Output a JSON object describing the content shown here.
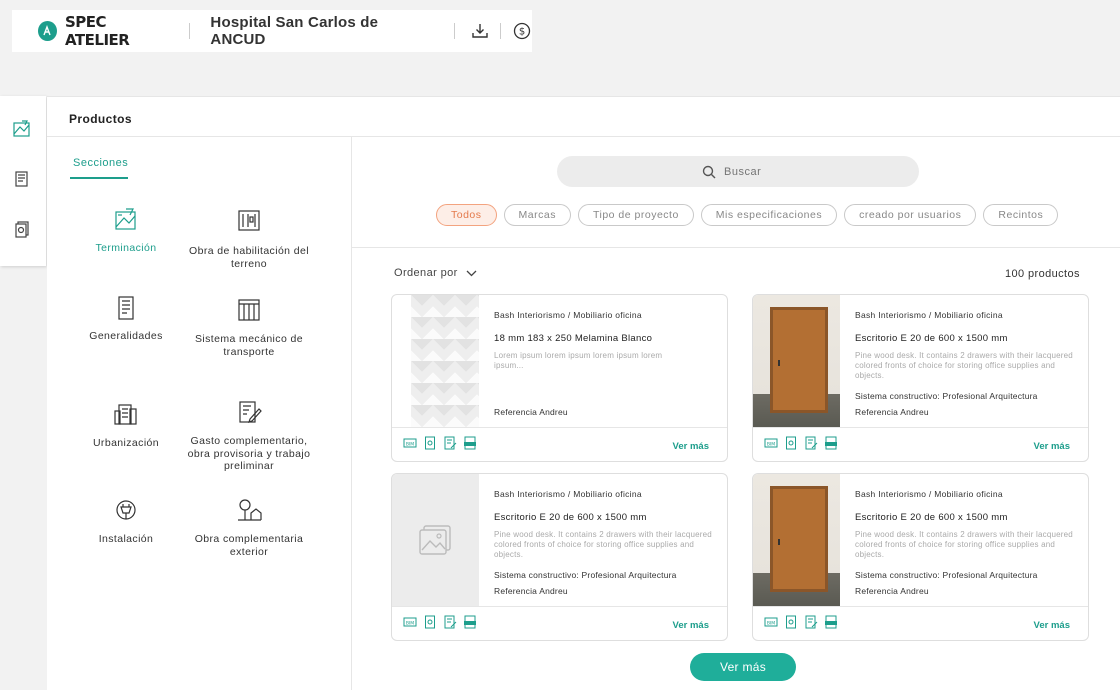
{
  "app": {
    "name": "SPEC ATELIER",
    "project": "Hospital San Carlos de ANCUD"
  },
  "colors": {
    "accent": "#1d9e8c",
    "chip_active": "#e47a4c"
  },
  "panel": {
    "title": "Productos"
  },
  "sections": {
    "label": "Secciones",
    "items": [
      {
        "label": "Terminación",
        "icon": "finishes-icon",
        "active": true
      },
      {
        "label": "Obra de habilitación del terreno",
        "icon": "site-prep-icon"
      },
      {
        "label": "Generalidades",
        "icon": "document-icon"
      },
      {
        "label": "Sistema mecánico de transporte",
        "icon": "elevator-icon"
      },
      {
        "label": "Urbanización",
        "icon": "buildings-icon"
      },
      {
        "label": "Gasto complementario, obra provisoria y trabajo preliminar",
        "icon": "edit-document-icon"
      },
      {
        "label": "Instalación",
        "icon": "plug-icon"
      },
      {
        "label": "Obra complementaria exterior",
        "icon": "landscape-icon"
      }
    ]
  },
  "search": {
    "placeholder": "Buscar"
  },
  "filters": [
    "Todos",
    "Marcas",
    "Tipo de proyecto",
    "Mis especificaciones",
    "creado por usuarios",
    "Recintos"
  ],
  "sort": {
    "label": "Ordenar por"
  },
  "count": "100 productos",
  "products": [
    {
      "brand": "Bash Interiorismo / Mobiliario oficina",
      "name": "18 mm 183 x 250 Melamina Blanco",
      "description": "Lorem ipsum lorem ipsum lorem ipsum lorem ipsum...",
      "system": "",
      "reference": "Referencia Andreu",
      "more": "Ver más",
      "image": "tiles"
    },
    {
      "brand": "Bash Interiorismo / Mobiliario oficina",
      "name": "Escritorio E 20 de 600 x 1500 mm",
      "description": "Pine wood desk. It contains 2 drawers with their lacquered colored fronts of choice for storing office supplies and objects.",
      "system": "Sistema constructivo: Profesional Arquitectura",
      "reference": "Referencia Andreu",
      "more": "Ver más",
      "image": "door"
    },
    {
      "brand": "Bash Interiorismo / Mobiliario oficina",
      "name": "Escritorio E 20 de 600 x 1500 mm",
      "description": "Pine wood desk. It contains 2 drawers with their lacquered colored fronts of choice for storing office supplies and objects.",
      "system": "Sistema constructivo: Profesional Arquitectura",
      "reference": "Referencia Andreu",
      "more": "Ver más",
      "image": "placeholder"
    },
    {
      "brand": "Bash Interiorismo / Mobiliario oficina",
      "name": "Escritorio E 20 de 600 x 1500 mm",
      "description": "Pine wood desk. It contains 2 drawers with their lacquered colored fronts of choice for storing office supplies and objects.",
      "system": "Sistema constructivo: Profesional Arquitectura",
      "reference": "Referencia Andreu",
      "more": "Ver más",
      "image": "door"
    }
  ],
  "load_more": "Ver más"
}
